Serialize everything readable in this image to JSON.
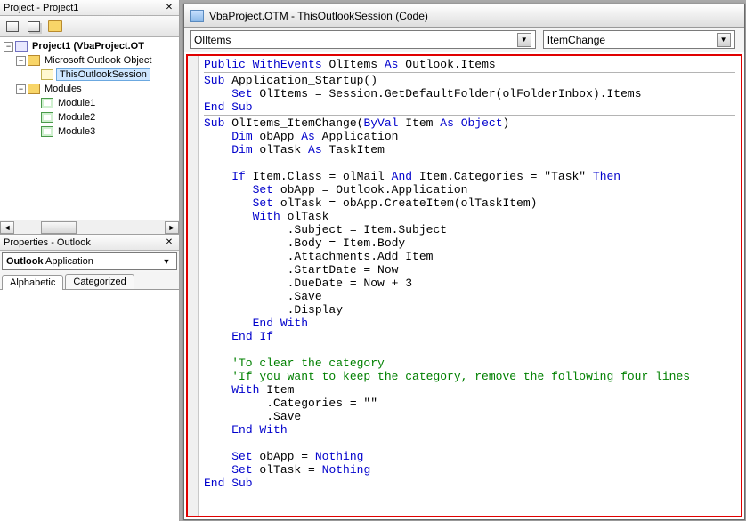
{
  "project_panel": {
    "title": "Project - Project1",
    "root": "Project1 (VbaProject.OT",
    "ms_outlook_objects": "Microsoft Outlook Object",
    "this_outlook_session": "ThisOutlookSession",
    "modules_folder": "Modules",
    "modules": [
      "Module1",
      "Module2",
      "Module3"
    ]
  },
  "properties_panel": {
    "title": "Properties - Outlook",
    "object_name": "Outlook",
    "object_type": "Application",
    "tabs": {
      "alphabetic": "Alphabetic",
      "categorized": "Categorized"
    }
  },
  "code_window": {
    "title": "VbaProject.OTM - ThisOutlookSession (Code)",
    "left_combo": "OlItems",
    "right_combo": "ItemChange"
  },
  "expanders": {
    "minus": "−",
    "plus": "+"
  },
  "dropdown_glyph": "▼",
  "close_glyph": "✕",
  "scroll": {
    "left": "◄",
    "right": "►"
  },
  "code": {
    "l1a": "Public",
    "l1b": "WithEvents",
    "l1c": " OlItems ",
    "l1d": "As",
    "l1e": " Outlook.Items",
    "l2a": "Sub",
    "l2b": " Application_Startup()",
    "l3a": "    ",
    "l3b": "Set",
    "l3c": " OlItems = Session.GetDefaultFolder(olFolderInbox).Items",
    "l4a": "End Sub",
    "l5a": "Sub",
    "l5b": " OlItems_ItemChange(",
    "l5c": "ByVal",
    "l5d": " Item ",
    "l5e": "As",
    "l5f": " ",
    "l5g": "Object",
    "l5h": ")",
    "l6a": "    ",
    "l6b": "Dim",
    "l6c": " obApp ",
    "l6d": "As",
    "l6e": " Application",
    "l7a": "    ",
    "l7b": "Dim",
    "l7c": " olTask ",
    "l7d": "As",
    "l7e": " TaskItem",
    "l8": "",
    "l9a": "    ",
    "l9b": "If",
    "l9c": " Item.Class = olMail ",
    "l9d": "And",
    "l9e": " Item.Categories = \"Task\" ",
    "l9f": "Then",
    "l10a": "       ",
    "l10b": "Set",
    "l10c": " obApp = Outlook.Application",
    "l11a": "       ",
    "l11b": "Set",
    "l11c": " olTask = obApp.CreateItem(olTaskItem)",
    "l12a": "       ",
    "l12b": "With",
    "l12c": " olTask",
    "l13": "            .Subject = Item.Subject",
    "l14": "            .Body = Item.Body",
    "l15": "            .Attachments.Add Item",
    "l16": "            .StartDate = Now",
    "l17": "            .DueDate = Now + 3",
    "l18": "            .Save",
    "l19": "            .Display",
    "l20a": "       ",
    "l20b": "End With",
    "l21a": "    ",
    "l21b": "End If",
    "l22": "",
    "l23": "    'To clear the category",
    "l24": "    'If you want to keep the category, remove the following four lines",
    "l25a": "    ",
    "l25b": "With",
    "l25c": " Item",
    "l26": "         .Categories = \"\"",
    "l27": "         .Save",
    "l28a": "    ",
    "l28b": "End With",
    "l29": "",
    "l30a": "    ",
    "l30b": "Set",
    "l30c": " obApp = ",
    "l30d": "Nothing",
    "l31a": "    ",
    "l31b": "Set",
    "l31c": " olTask = ",
    "l31d": "Nothing",
    "l32a": "End Sub"
  }
}
